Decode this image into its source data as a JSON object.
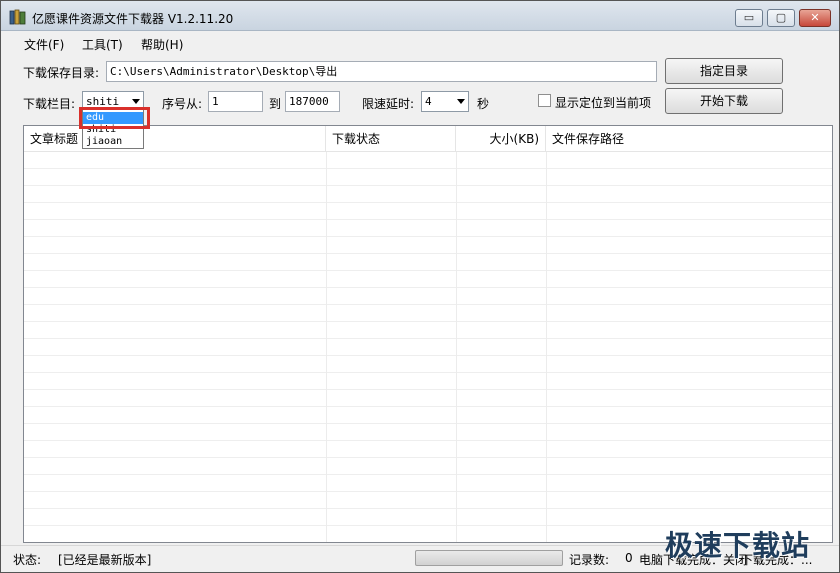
{
  "window": {
    "title": "亿愿课件资源文件下载器 V1.2.11.20",
    "controls": {
      "minimize": "▭",
      "restore": "▢",
      "close": "✕"
    }
  },
  "menu": {
    "items": [
      "文件(F)",
      "工具(T)",
      "帮助(H)"
    ]
  },
  "form": {
    "save_dir_label": "下载保存目录:",
    "save_dir_value": "C:\\Users\\Administrator\\Desktop\\导出",
    "set_dir_button": "指定目录",
    "column_label": "下载栏目:",
    "column_value": "shiti",
    "column_options": [
      "edu",
      "shiti",
      "jiaoan"
    ],
    "column_highlighted": "edu",
    "seq_from_label": "序号从:",
    "seq_from_value": "1",
    "seq_to_label": "到",
    "seq_to_value": "187000",
    "delay_label": "限速延时:",
    "delay_value": "4",
    "delay_unit": "秒",
    "locate_checkbox_label": "显示定位到当前项",
    "locate_checked": false,
    "start_button": "开始下载"
  },
  "list": {
    "columns": [
      "文章标题",
      "下载状态",
      "大小(KB)",
      "文件保存路径"
    ],
    "rows": []
  },
  "status": {
    "label": "状态:",
    "message": "[已经是最新版本]",
    "progress_percent": 0,
    "records_label": "记录数:",
    "records_value": "0",
    "shutdown_text": "电脑下载完成：关闭",
    "download_done_text": "下载完成：..."
  },
  "watermark": "极速下载站",
  "colors": {
    "highlight": "#d9302b",
    "selection": "#3399ff"
  }
}
